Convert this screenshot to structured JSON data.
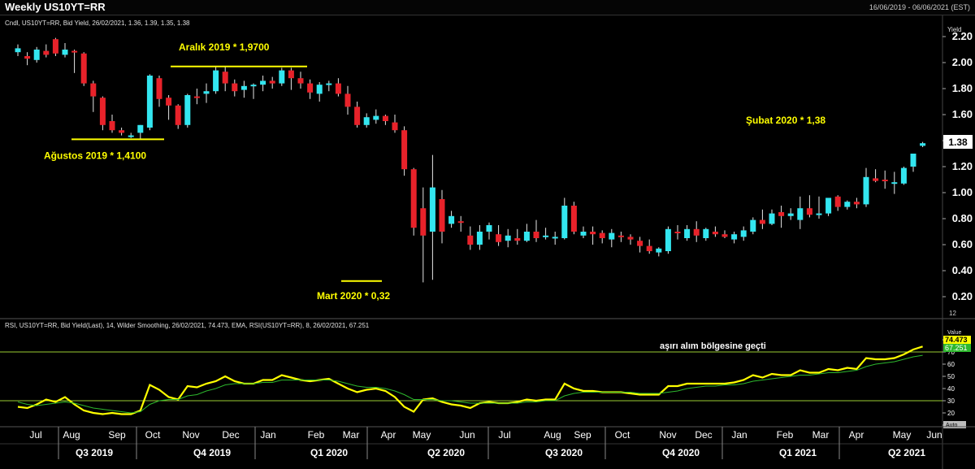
{
  "window": {
    "title": "Weekly US10YT=RR",
    "date_range": "16/06/2019 - 06/06/2021 (EST)"
  },
  "colors": {
    "background": "#000000",
    "up_candle": "#33e6f0",
    "down_candle": "#e8222a",
    "annotation": "#ffff00",
    "rsi_line": "#ffff00",
    "ema_line": "#2db82d",
    "axis_text": "#ffffff",
    "panel_text": "#e0e0e0"
  },
  "chart_data": [
    {
      "type": "candlestick",
      "header": "Cndl, US10YT=RR, Bid Yield, 26/02/2021, 1.36, 1.39, 1.35, 1.38",
      "ylabel": "Yield",
      "ylim": [
        0.1,
        2.2
      ],
      "yticks": [
        "2.20",
        "2.00",
        "1.80",
        "1.60",
        "1.40",
        "1.20",
        "1.00",
        "0.80",
        "0.60",
        "0.40",
        "0.20"
      ],
      "current_value_label": "1.38",
      "bottom_label": "12",
      "ohlc": [
        [
          2.08,
          2.14,
          2.05,
          2.11
        ],
        [
          2.05,
          2.08,
          1.98,
          2.03
        ],
        [
          2.02,
          2.12,
          2.0,
          2.1
        ],
        [
          2.09,
          2.14,
          2.04,
          2.06
        ],
        [
          2.18,
          2.19,
          2.05,
          2.07
        ],
        [
          2.06,
          2.15,
          2.04,
          2.1
        ],
        [
          2.09,
          2.1,
          1.92,
          2.08
        ],
        [
          2.07,
          2.08,
          1.82,
          1.84
        ],
        [
          1.84,
          1.86,
          1.62,
          1.74
        ],
        [
          1.73,
          1.74,
          1.48,
          1.52
        ],
        [
          1.55,
          1.6,
          1.46,
          1.48
        ],
        [
          1.48,
          1.5,
          1.44,
          1.46
        ],
        [
          1.43,
          1.46,
          1.42,
          1.44
        ],
        [
          1.46,
          1.52,
          1.41,
          1.52
        ],
        [
          1.5,
          1.91,
          1.48,
          1.9
        ],
        [
          1.88,
          1.9,
          1.66,
          1.72
        ],
        [
          1.73,
          1.75,
          1.56,
          1.67
        ],
        [
          1.67,
          1.68,
          1.49,
          1.52
        ],
        [
          1.52,
          1.76,
          1.5,
          1.75
        ],
        [
          1.74,
          1.8,
          1.68,
          1.73
        ],
        [
          1.76,
          1.84,
          1.69,
          1.78
        ],
        [
          1.78,
          1.97,
          1.76,
          1.94
        ],
        [
          1.93,
          1.97,
          1.78,
          1.84
        ],
        [
          1.84,
          1.87,
          1.74,
          1.78
        ],
        [
          1.79,
          1.86,
          1.73,
          1.82
        ],
        [
          1.82,
          1.84,
          1.72,
          1.83
        ],
        [
          1.83,
          1.9,
          1.78,
          1.86
        ],
        [
          1.86,
          1.89,
          1.8,
          1.84
        ],
        [
          1.84,
          1.96,
          1.82,
          1.94
        ],
        [
          1.94,
          1.96,
          1.79,
          1.88
        ],
        [
          1.88,
          1.93,
          1.8,
          1.84
        ],
        [
          1.84,
          1.87,
          1.72,
          1.77
        ],
        [
          1.76,
          1.85,
          1.7,
          1.83
        ],
        [
          1.83,
          1.86,
          1.78,
          1.84
        ],
        [
          1.84,
          1.88,
          1.74,
          1.76
        ],
        [
          1.76,
          1.82,
          1.6,
          1.66
        ],
        [
          1.66,
          1.7,
          1.5,
          1.52
        ],
        [
          1.52,
          1.61,
          1.5,
          1.58
        ],
        [
          1.56,
          1.64,
          1.53,
          1.59
        ],
        [
          1.59,
          1.6,
          1.52,
          1.55
        ],
        [
          1.54,
          1.6,
          1.46,
          1.48
        ],
        [
          1.48,
          1.51,
          1.13,
          1.18
        ],
        [
          1.18,
          1.19,
          0.67,
          0.73
        ],
        [
          0.88,
          1.04,
          0.31,
          0.67
        ],
        [
          0.7,
          1.29,
          0.33,
          1.04
        ],
        [
          0.95,
          1.02,
          0.61,
          0.7
        ],
        [
          0.76,
          0.86,
          0.73,
          0.82
        ],
        [
          0.78,
          0.82,
          0.7,
          0.77
        ],
        [
          0.67,
          0.74,
          0.56,
          0.6
        ],
        [
          0.6,
          0.75,
          0.56,
          0.7
        ],
        [
          0.7,
          0.77,
          0.64,
          0.75
        ],
        [
          0.68,
          0.75,
          0.59,
          0.62
        ],
        [
          0.63,
          0.72,
          0.58,
          0.67
        ],
        [
          0.65,
          0.72,
          0.6,
          0.63
        ],
        [
          0.63,
          0.76,
          0.62,
          0.7
        ],
        [
          0.7,
          0.79,
          0.62,
          0.65
        ],
        [
          0.66,
          0.73,
          0.64,
          0.67
        ],
        [
          0.66,
          0.7,
          0.6,
          0.66
        ],
        [
          0.65,
          0.96,
          0.64,
          0.9
        ],
        [
          0.9,
          0.93,
          0.68,
          0.7
        ],
        [
          0.67,
          0.74,
          0.65,
          0.7
        ],
        [
          0.7,
          0.74,
          0.6,
          0.68
        ],
        [
          0.69,
          0.71,
          0.61,
          0.65
        ],
        [
          0.64,
          0.72,
          0.58,
          0.69
        ],
        [
          0.67,
          0.7,
          0.62,
          0.66
        ],
        [
          0.66,
          0.68,
          0.6,
          0.64
        ],
        [
          0.63,
          0.66,
          0.54,
          0.59
        ],
        [
          0.59,
          0.64,
          0.53,
          0.55
        ],
        [
          0.54,
          0.58,
          0.51,
          0.57
        ],
        [
          0.55,
          0.74,
          0.53,
          0.72
        ],
        [
          0.7,
          0.75,
          0.64,
          0.69
        ],
        [
          0.65,
          0.75,
          0.63,
          0.72
        ],
        [
          0.72,
          0.78,
          0.62,
          0.67
        ],
        [
          0.65,
          0.73,
          0.63,
          0.72
        ],
        [
          0.7,
          0.74,
          0.66,
          0.68
        ],
        [
          0.68,
          0.71,
          0.65,
          0.66
        ],
        [
          0.64,
          0.7,
          0.61,
          0.68
        ],
        [
          0.66,
          0.74,
          0.63,
          0.71
        ],
        [
          0.7,
          0.81,
          0.68,
          0.79
        ],
        [
          0.79,
          0.87,
          0.72,
          0.76
        ],
        [
          0.76,
          0.87,
          0.75,
          0.84
        ],
        [
          0.85,
          0.9,
          0.73,
          0.82
        ],
        [
          0.82,
          0.88,
          0.79,
          0.84
        ],
        [
          0.79,
          0.97,
          0.72,
          0.88
        ],
        [
          0.88,
          0.98,
          0.81,
          0.83
        ],
        [
          0.84,
          0.97,
          0.8,
          0.84
        ],
        [
          0.84,
          0.95,
          0.82,
          0.96
        ],
        [
          0.97,
          0.98,
          0.86,
          0.89
        ],
        [
          0.89,
          0.94,
          0.87,
          0.93
        ],
        [
          0.93,
          0.96,
          0.88,
          0.91
        ],
        [
          0.91,
          1.19,
          0.89,
          1.12
        ],
        [
          1.11,
          1.18,
          1.08,
          1.09
        ],
        [
          1.1,
          1.17,
          1.03,
          1.09
        ],
        [
          1.08,
          1.16,
          0.99,
          1.08
        ],
        [
          1.07,
          1.2,
          1.06,
          1.19
        ],
        [
          1.2,
          1.3,
          1.16,
          1.3
        ],
        [
          1.36,
          1.39,
          1.35,
          1.38
        ]
      ],
      "annotations": [
        {
          "text": "Aralık 2019 * 1,9700",
          "level": 1.97
        },
        {
          "text": "Ağustos 2019 * 1,4100",
          "level": 1.41
        },
        {
          "text": "Mart 2020 * 0,32",
          "level": 0.32
        },
        {
          "text": "Şubat 2020 * 1,38",
          "level": 1.38
        }
      ]
    },
    {
      "type": "line",
      "header": "RSI, US10YT=RR, Bid Yield(Last),  14, Wilder Smoothing, 26/02/2021, 74.473, EMA, RSI(US10YT=RR),  8, 26/02/2021, 67.251",
      "ylabel": "Value",
      "ylim": [
        15,
        85
      ],
      "yticks": [
        "80",
        "70",
        "60",
        "50",
        "40",
        "30",
        "20",
        "10"
      ],
      "levels": [
        30,
        70
      ],
      "value_labels": [
        "74.473",
        "67.251"
      ],
      "auto_label": "Auto",
      "annotation": "aşırı alım bölgesine geçti",
      "series": [
        {
          "name": "RSI",
          "values": [
            25,
            24,
            27,
            31,
            29,
            33,
            27,
            22,
            20,
            19,
            20,
            19,
            19,
            22,
            43,
            39,
            33,
            31,
            42,
            41,
            44,
            46,
            50,
            46,
            44,
            44,
            47,
            47,
            51,
            49,
            47,
            46,
            47,
            48,
            44,
            40,
            37,
            39,
            40,
            38,
            33,
            25,
            21,
            31,
            32,
            29,
            27,
            26,
            24,
            28,
            29,
            28,
            28,
            29,
            31,
            30,
            31,
            31,
            44,
            40,
            38,
            38,
            37,
            37,
            37,
            36,
            35,
            35,
            35,
            42,
            42,
            44,
            44,
            44,
            44,
            44,
            45,
            47,
            51,
            49,
            52,
            51,
            51,
            55,
            53,
            53,
            56,
            55,
            57,
            56,
            65,
            64,
            64,
            65,
            68,
            72,
            74.473
          ]
        },
        {
          "name": "EMA",
          "values": [
            29,
            27,
            26,
            27,
            28,
            29,
            28,
            26,
            24,
            23,
            22,
            21,
            20,
            21,
            27,
            30,
            31,
            31,
            34,
            35,
            38,
            40,
            43,
            44,
            44,
            44,
            45,
            45,
            47,
            47,
            47,
            47,
            47,
            47,
            46,
            44,
            42,
            41,
            41,
            40,
            38,
            35,
            31,
            31,
            31,
            30,
            30,
            29,
            28,
            28,
            28,
            28,
            28,
            28,
            29,
            29,
            30,
            30,
            34,
            36,
            37,
            37,
            37,
            37,
            37,
            37,
            36,
            36,
            36,
            37,
            38,
            40,
            41,
            42,
            42,
            43,
            43,
            44,
            46,
            47,
            48,
            49,
            50,
            51,
            51,
            52,
            53,
            53,
            54,
            55,
            58,
            60,
            61,
            62,
            64,
            66,
            67.251
          ]
        }
      ]
    }
  ],
  "x_axis": {
    "months": [
      "Jul",
      "Aug",
      "Sep",
      "Oct",
      "Nov",
      "Dec",
      "Jan",
      "Feb",
      "Mar",
      "Apr",
      "May",
      "Jun",
      "Jul",
      "Aug",
      "Sep",
      "Oct",
      "Nov",
      "Dec",
      "Jan",
      "Feb",
      "Mar",
      "Apr",
      "May",
      "Jun"
    ],
    "quarters": [
      "Q3 2019",
      "Q4 2019",
      "Q1 2020",
      "Q2 2020",
      "Q3 2020",
      "Q4 2020",
      "Q1 2021",
      "Q2 2021"
    ]
  }
}
